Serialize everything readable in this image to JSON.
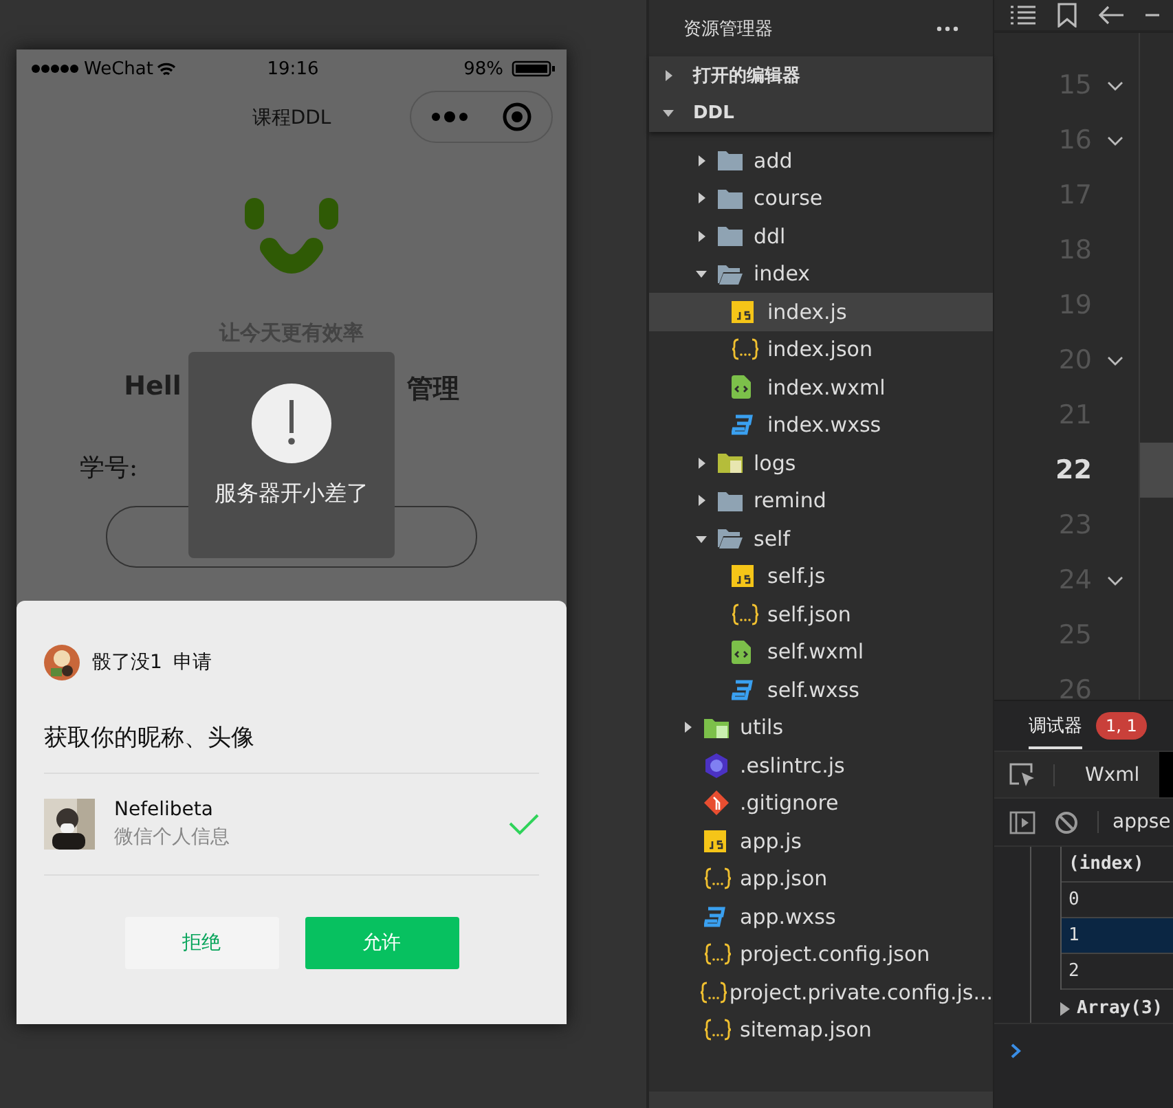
{
  "phone": {
    "status_bar": {
      "carrier": "WeChat",
      "time": "19:16",
      "battery": "98%"
    },
    "nav_title": "课程DDL",
    "tagline": "让今天更有效率",
    "heading_left": "Hell",
    "heading_right": "管理",
    "student_id_label": "学号:",
    "toast": {
      "message": "服务器开小差了"
    },
    "auth_sheet": {
      "app_name": "骰了没1",
      "action": "申请",
      "request": "获取你的昵称、头像",
      "account": {
        "name": "Nefelibeta",
        "subtitle": "微信个人信息",
        "selected": true
      },
      "buttons": [
        {
          "label": "拒绝",
          "kind": "secondary"
        },
        {
          "label": "允许",
          "kind": "primary"
        }
      ]
    }
  },
  "explorer": {
    "title": "资源管理器",
    "sections": [
      {
        "label": "打开的编辑器",
        "expanded": false
      },
      {
        "label": "DDL",
        "expanded": true
      }
    ],
    "tree": [
      {
        "kind": "group",
        "children": [
          {
            "label": "add",
            "kind": "folder",
            "expanded": false,
            "selected": false
          },
          {
            "label": "course",
            "kind": "folder",
            "expanded": false,
            "selected": false
          },
          {
            "label": "ddl",
            "kind": "folder",
            "expanded": false,
            "selected": false
          },
          {
            "label": "index",
            "kind": "folder",
            "expanded": true,
            "selected": false,
            "children": [
              {
                "label": "index.js",
                "kind": "js",
                "selected": true
              },
              {
                "label": "index.json",
                "kind": "json",
                "selected": false
              },
              {
                "label": "index.wxml",
                "kind": "wxml",
                "selected": false
              },
              {
                "label": "index.wxss",
                "kind": "wxss",
                "selected": false
              }
            ]
          },
          {
            "label": "logs",
            "kind": "logs-folder",
            "expanded": false,
            "selected": false
          },
          {
            "label": "remind",
            "kind": "folder",
            "expanded": false,
            "selected": false
          },
          {
            "label": "self",
            "kind": "folder",
            "expanded": true,
            "selected": false,
            "children": [
              {
                "label": "self.js",
                "kind": "js",
                "selected": false
              },
              {
                "label": "self.json",
                "kind": "json",
                "selected": false
              },
              {
                "label": "self.wxml",
                "kind": "wxml",
                "selected": false
              },
              {
                "label": "self.wxss",
                "kind": "wxss",
                "selected": false
              }
            ]
          }
        ]
      },
      {
        "label": "utils",
        "kind": "utils-folder",
        "expanded": false,
        "selected": false
      },
      {
        "label": ".eslintrc.js",
        "kind": "eslint",
        "selected": false
      },
      {
        "label": ".gitignore",
        "kind": "git",
        "selected": false
      },
      {
        "label": "app.js",
        "kind": "js",
        "selected": false
      },
      {
        "label": "app.json",
        "kind": "json",
        "selected": false
      },
      {
        "label": "app.wxss",
        "kind": "wxss",
        "selected": false
      },
      {
        "label": "project.config.json",
        "kind": "json",
        "selected": false
      },
      {
        "label": "project.private.config.js...",
        "kind": "json",
        "selected": false
      },
      {
        "label": "sitemap.json",
        "kind": "json",
        "selected": false
      }
    ]
  },
  "editor": {
    "lines": [
      {
        "number": "15",
        "foldable": true,
        "current": false
      },
      {
        "number": "16",
        "foldable": true,
        "current": false
      },
      {
        "number": "17",
        "foldable": false,
        "current": false
      },
      {
        "number": "18",
        "foldable": false,
        "current": false
      },
      {
        "number": "19",
        "foldable": false,
        "current": false
      },
      {
        "number": "20",
        "foldable": true,
        "current": false
      },
      {
        "number": "21",
        "foldable": false,
        "current": false
      },
      {
        "number": "22",
        "foldable": false,
        "current": true
      },
      {
        "number": "23",
        "foldable": false,
        "current": false
      },
      {
        "number": "24",
        "foldable": true,
        "current": false
      },
      {
        "number": "25",
        "foldable": false,
        "current": false
      },
      {
        "number": "26",
        "foldable": false,
        "current": false
      }
    ]
  },
  "debugger": {
    "tab": "调试器",
    "badge": "1, 1",
    "panel_tab": "Wxml",
    "filter": "appse",
    "table": {
      "header": "(index)",
      "rows": [
        {
          "index": "0",
          "selected": false
        },
        {
          "index": "1",
          "selected": true
        },
        {
          "index": "2",
          "selected": false
        }
      ]
    },
    "summary": "Array(3)"
  }
}
